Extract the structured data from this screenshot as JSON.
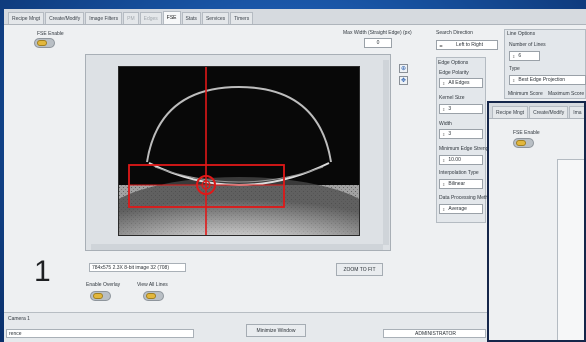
{
  "tabs": [
    {
      "label": "Recipe Mngt",
      "state": "normal"
    },
    {
      "label": "Create/Modify",
      "state": "normal"
    },
    {
      "label": "Image Filters",
      "state": "normal"
    },
    {
      "label": "PM",
      "state": "dim"
    },
    {
      "label": "Edges",
      "state": "dim"
    },
    {
      "label": "FSE",
      "state": "active"
    },
    {
      "label": "Stats",
      "state": "normal"
    },
    {
      "label": "Services",
      "state": "normal"
    },
    {
      "label": "Timers",
      "state": "normal"
    }
  ],
  "fse_enable_label": "FSE Enable",
  "max_width_label": "Max Width (Straight Edge) (px)",
  "max_width_value": "0",
  "search_direction": {
    "label": "Search Direction",
    "value": "Left to Right"
  },
  "line_options": {
    "title": "Line Options",
    "num_lines_label": "Number of Lines",
    "num_lines_value": "6",
    "type_label": "Type",
    "type_value": "Best Edge Projection",
    "min_score_label": "Minimum Score",
    "max_score_label": "Maximum Score"
  },
  "edge_options": {
    "title": "Edge Options",
    "polarity_label": "Edge Polarity",
    "polarity_value": "All Edges",
    "kernel_label": "Kernel Size",
    "kernel_value": "3",
    "width_label": "Width",
    "width_value": "3",
    "min_strength_label": "Minimum Edge Strength",
    "min_strength_value": "10.00",
    "interp_label": "Interpolation Type",
    "interp_value": "Bilinear",
    "processing_label": "Data Processing Method",
    "processing_value": "Average"
  },
  "image_info": "784x575 2.3X 8-bit image 32   (708)",
  "zoom_to_fit": "ZOOM TO FIT",
  "camera_number": "1",
  "enable_overlay_label": "Enable Overlay",
  "view_all_lines_label": "View All Lines",
  "camera_label": "Camera 1",
  "status_left": "rence",
  "minimize_window": "Minimize Window",
  "user_role": "ADMINISTRATOR",
  "overlay_window": {
    "tabs": [
      "Recipe Mngt",
      "Create/Modify",
      "Ima"
    ],
    "fse_enable_label": "FSE Enable"
  },
  "colors": {
    "accent_red": "#e01818",
    "toggle_knob": "#e2b73d",
    "desktop": "#17519f"
  }
}
